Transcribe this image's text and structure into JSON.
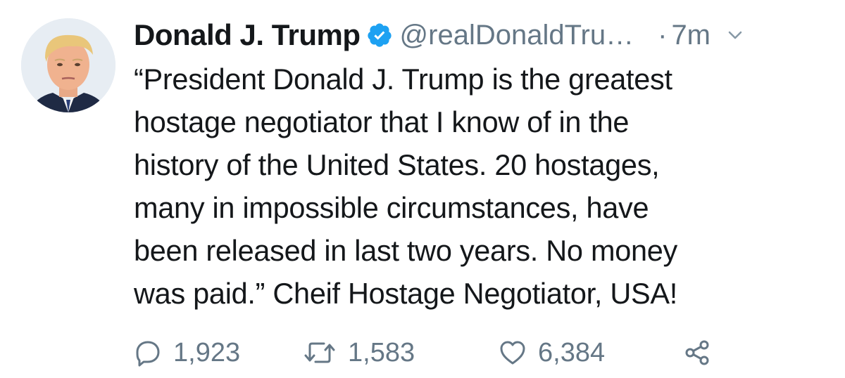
{
  "tweet": {
    "display_name": "Donald J. Trump",
    "verified": true,
    "handle": "@realDonaldTru…",
    "separator": "·",
    "time": "7m",
    "text": "“President Donald J. Trump is the greatest\nhostage negotiator that I know of in the\nhistory of the United States. 20 hostages,\nmany in impossible circumstances, have\nbeen released in last two years. No money\nwas paid.” Cheif Hostage Negotiator, USA!",
    "actions": {
      "reply_count": "1,923",
      "retweet_count": "1,583",
      "like_count": "6,384"
    }
  },
  "icons": {
    "verified": "verified-badge-icon",
    "caret": "chevron-down-icon",
    "reply": "reply-icon",
    "retweet": "retweet-icon",
    "like": "heart-icon",
    "share": "share-icon"
  },
  "colors": {
    "text": "#14171a",
    "secondary": "#657786",
    "verified_blue": "#1da1f2",
    "background": "#ffffff"
  }
}
